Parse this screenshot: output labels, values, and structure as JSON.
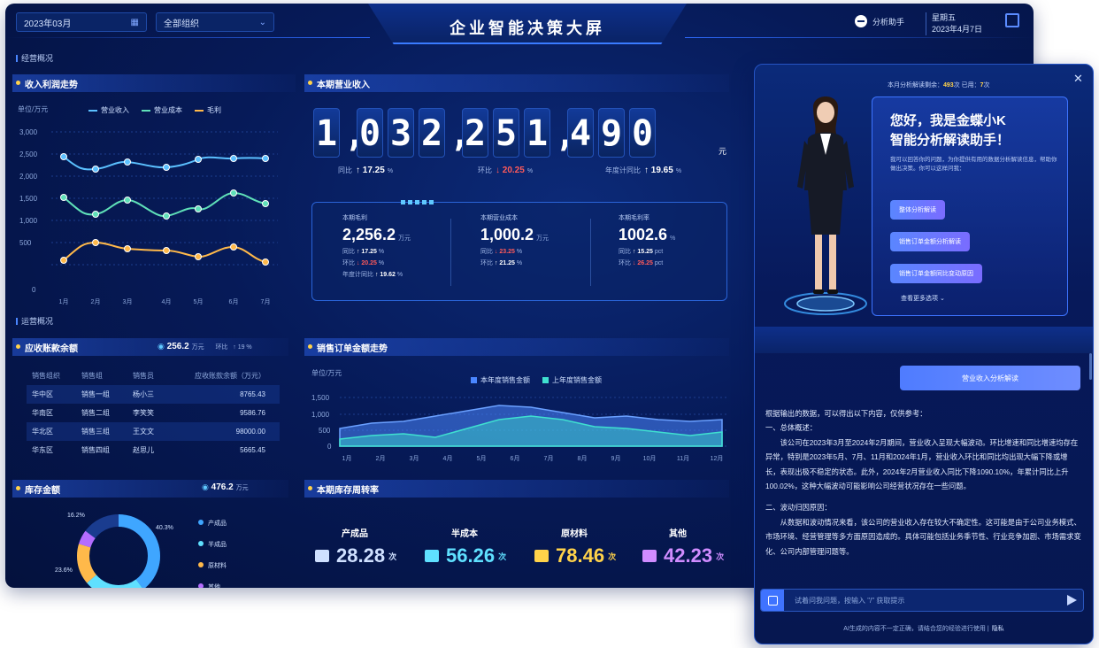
{
  "header": {
    "month": "2023年03月",
    "org": "全部组织",
    "title": "企业智能决策大屏",
    "assistant_label": "分析助手",
    "weekday": "星期五",
    "date": "2023年4月7日"
  },
  "overview_label": "经营概况",
  "ops_label": "运营概况",
  "income_chart": {
    "title": "收入利润走势",
    "unit": "单位/万元",
    "legend": [
      "营业收入",
      "营业成本",
      "毛利"
    ],
    "colors": [
      "#5bc0ff",
      "#5fe0b8",
      "#ffb94a"
    ],
    "y_ticks": [
      "3,000",
      "2,500",
      "2,000",
      "1,500",
      "1,000",
      "500",
      "0"
    ],
    "categories": [
      "1月",
      "2月",
      "3月",
      "4月",
      "5月",
      "6月",
      "7月"
    ]
  },
  "revenue": {
    "title": "本期营业收入",
    "digits": [
      "1",
      ",",
      "0",
      "3",
      "2",
      ",",
      "2",
      "5",
      "1",
      ",",
      "4",
      "9",
      "0"
    ],
    "unit": "元",
    "yoy_label": "同比",
    "yoy_value": "17.25",
    "yoy_suffix": "%",
    "mom_label": "环比",
    "mom_value": "20.25",
    "mom_suffix": "%",
    "ytd_label": "年度计同比",
    "ytd_value": "19.65",
    "ytd_suffix": "%"
  },
  "kpis": [
    {
      "name": "本期毛利",
      "value": "2,256.2",
      "unit": "万元",
      "r1_label": "同比",
      "r1": "17.25",
      "r2_label": "环比",
      "r2": "20.25",
      "r3_label": "年度计同比",
      "r3": "19.62"
    },
    {
      "name": "本期营业成本",
      "value": "1,000.2",
      "unit": "万元",
      "r1_label": "同比",
      "r1": "23.25",
      "r2_label": "环比",
      "r2": "21.25"
    },
    {
      "name": "本期毛利率",
      "value": "1002.6",
      "unit": "%",
      "r1_label": "同比",
      "r1": "15.25",
      "r2_label": "环比",
      "r2": "26.25"
    }
  ],
  "receivable": {
    "title": "应收账款余额",
    "total": "256.2",
    "total_unit": "万元",
    "mom_label": "环比",
    "mom_value": "19",
    "headers": [
      "销售组织",
      "销售组",
      "销售员",
      "应收账款余额（万元）"
    ],
    "rows": [
      [
        "华中区",
        "销售一组",
        "杨小三",
        "8765.43"
      ],
      [
        "华南区",
        "销售二组",
        "李笑笑",
        "9586.76"
      ],
      [
        "华北区",
        "销售三组",
        "王文文",
        "98000.00"
      ],
      [
        "华东区",
        "销售四组",
        "赵思儿",
        "5665.45"
      ]
    ]
  },
  "inventory": {
    "title": "库存金额",
    "total": "476.2",
    "total_unit": "万元",
    "legend": [
      "产成品",
      "半成品",
      "原材料",
      "其他"
    ],
    "legend_colors": [
      "#3fa6ff",
      "#5fe0ff",
      "#ffb94a",
      "#b46cff"
    ],
    "labels": [
      "16.2%",
      "40.3%",
      "23.6%"
    ]
  },
  "sales_chart": {
    "title": "销售订单金额走势",
    "unit": "单位/万元",
    "legend": [
      "本年度销售金额",
      "上年度销售金额"
    ],
    "colors": [
      "#4a86ff",
      "#3fe0d0"
    ],
    "y_ticks": [
      "1,500",
      "1,000",
      "500",
      "0"
    ],
    "categories": [
      "1月",
      "2月",
      "3月",
      "4月",
      "5月",
      "6月",
      "7月",
      "8月",
      "9月",
      "10月",
      "11月",
      "12月"
    ]
  },
  "turnover": {
    "title": "本期库存周转率",
    "items": [
      {
        "name": "产成品",
        "value": "28.28",
        "suffix": "次",
        "color": "#cfe0ff"
      },
      {
        "name": "半成本",
        "value": "56.26",
        "suffix": "次",
        "color": "#5fe0ff"
      },
      {
        "name": "原材料",
        "value": "78.46",
        "suffix": "次",
        "color": "#ffd24a"
      },
      {
        "name": "其他",
        "value": "42.23",
        "suffix": "次",
        "color": "#d08cff"
      }
    ]
  },
  "assistant": {
    "quota_prefix": "本月分析解读剩余：",
    "quota_left": "493",
    "quota_mid": "次 已用：",
    "quota_used": "7",
    "quota_suffix": "次",
    "greet_line1": "您好，我是金蝶小K",
    "greet_line2": "智能分析解读助手！",
    "greet_sub": "我可以回答你的问题，为你提供有用的数据分析解读信息，帮助你做出决策。你可以这样问我：",
    "q1": "整体分析解读",
    "q2": "销售订单金额分析解读",
    "q3": "销售订单金额同比变动原因",
    "more": "查看更多选项",
    "chip": "营业收入分析解读",
    "answer_intro": "根据输出的数据，可以得出以下内容，仅供参考：",
    "answer_h1": "一、总体概述：",
    "answer_p1": "该公司在2023年3月至2024年2月期间，营业收入呈现大幅波动。环比增速和同比增速均存在异常，特别是2023年5月、7月、11月和2024年1月，营业收入环比和同比均出现大幅下降或增长，表现出极不稳定的状态。此外，2024年2月营业收入同比下降1090.10%，年累计同比上升100.02%，这种大幅波动可能影响公司经营状况存在一些问题。",
    "answer_h2": "二、波动归因原因：",
    "answer_p2": "从数据和波动情况来看，该公司的营业收入存在较大不确定性。这可能是由于公司业务模式、市场环境、经营管理等多方面原因造成的。具体可能包括业务季节性、行业竞争加剧、市场需求变化、公司内部管理问题等。",
    "input_placeholder": "试着问我问题，按输入 \"/\" 获取提示",
    "disclaimer": "AI生成的内容不一定正确，请结合您的经验进行使用",
    "disclaimer_link": "隐私"
  }
}
